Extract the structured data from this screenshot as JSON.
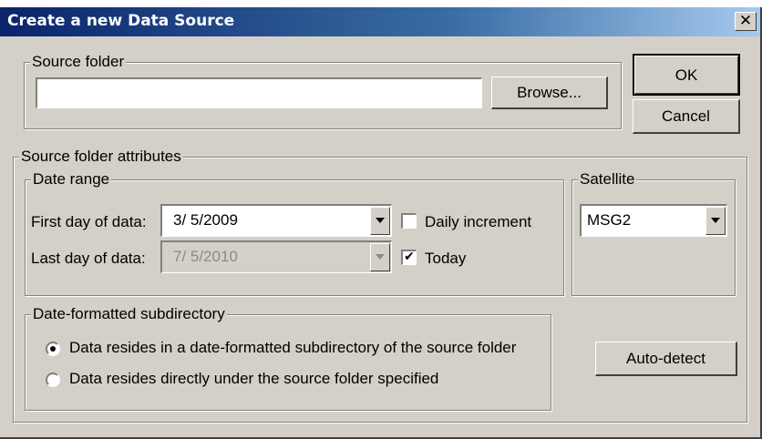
{
  "dialog": {
    "title": "Create a new Data Source",
    "close_glyph": "✕"
  },
  "source_folder": {
    "legend": "Source folder",
    "path_value": "",
    "browse_label": "Browse..."
  },
  "buttons": {
    "ok_label": "OK",
    "cancel_label": "Cancel",
    "auto_detect_label": "Auto-detect"
  },
  "attributes": {
    "legend": "Source folder attributes",
    "date_range": {
      "legend": "Date range",
      "first_day_label": "First day of data:",
      "first_day_value": "3/ 5/2009",
      "last_day_label": "Last day of data:",
      "last_day_value": "7/ 5/2010",
      "daily_increment_label": "Daily increment",
      "daily_increment_checked": false,
      "today_label": "Today",
      "today_checked": true,
      "check_glyph": "✔"
    },
    "satellite": {
      "legend": "Satellite",
      "selected": "MSG2"
    },
    "subdirectory": {
      "legend": "Date-formatted subdirectory",
      "options": [
        {
          "label": "Data resides in a date-formatted subdirectory of the source folder",
          "selected": true
        },
        {
          "label": "Data resides directly under the source folder specified",
          "selected": false
        }
      ]
    }
  },
  "icons": {
    "dropdown": "chevron-down-icon",
    "close": "close-icon",
    "check": "checkmark-icon"
  },
  "colors": {
    "face": "#d4d0c8",
    "title_start": "#0a246a",
    "title_end": "#a6caf0"
  }
}
